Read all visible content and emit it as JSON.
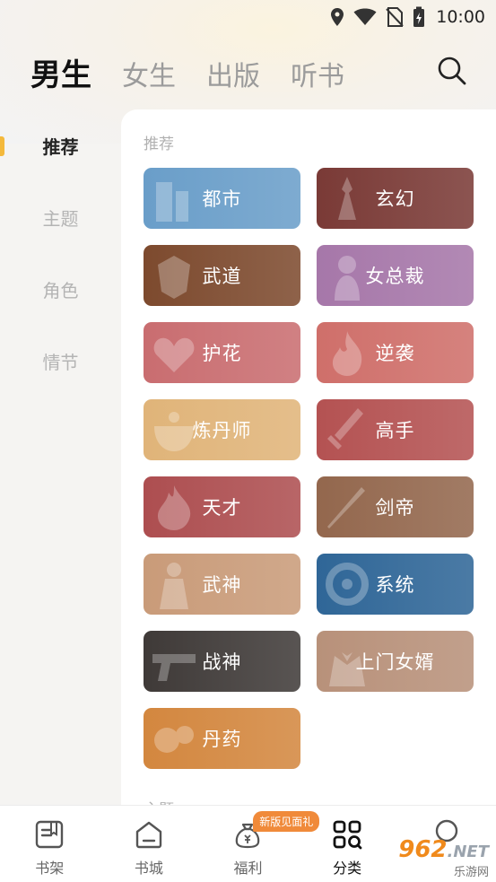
{
  "status_bar": {
    "time": "10:00",
    "icons": [
      "location-icon",
      "wifi-icon",
      "no-sim-icon",
      "battery-charging-icon"
    ]
  },
  "top_tabs": [
    {
      "label": "男生",
      "active": true
    },
    {
      "label": "女生",
      "active": false
    },
    {
      "label": "出版",
      "active": false
    },
    {
      "label": "听书",
      "active": false
    }
  ],
  "search_icon": "search-icon",
  "sidebar": {
    "items": [
      {
        "label": "推荐",
        "active": true
      },
      {
        "label": "主题",
        "active": false
      },
      {
        "label": "角色",
        "active": false
      },
      {
        "label": "情节",
        "active": false
      }
    ],
    "indicator_color": "#f4b93c"
  },
  "panel": {
    "section_title": "推荐",
    "next_section_title": "主题",
    "categories": [
      {
        "label": "都市",
        "color": "#6a9ec9",
        "icon": "building-icon"
      },
      {
        "label": "玄幻",
        "color": "#7a3a36",
        "icon": "warrior-icon"
      },
      {
        "label": "武道",
        "color": "#7d4a2e",
        "icon": "armor-icon"
      },
      {
        "label": "女总裁",
        "color": "#a677a9",
        "icon": "woman-icon"
      },
      {
        "label": "护花",
        "color": "#c96d70",
        "icon": "heart-icon"
      },
      {
        "label": "逆袭",
        "color": "#cf6f6a",
        "icon": "flame-icon"
      },
      {
        "label": "炼丹师",
        "color": "#e0b479",
        "icon": "cauldron-icon"
      },
      {
        "label": "高手",
        "color": "#b45252",
        "icon": "sword-icon"
      },
      {
        "label": "天才",
        "color": "#ad4e50",
        "icon": "fire-icon"
      },
      {
        "label": "剑帝",
        "color": "#93674d",
        "icon": "blade-icon"
      },
      {
        "label": "武神",
        "color": "#c99b79",
        "icon": "statue-icon"
      },
      {
        "label": "系统",
        "color": "#2f6697",
        "icon": "gear-icon"
      },
      {
        "label": "战神",
        "color": "#3f3a38",
        "icon": "gun-icon"
      },
      {
        "label": "上门女婿",
        "color": "#b8917a",
        "icon": "suit-icon"
      },
      {
        "label": "丹药",
        "color": "#d3873f",
        "icon": "pill-icon"
      }
    ]
  },
  "bottom_nav": {
    "items": [
      {
        "label": "书架",
        "icon": "bookshelf-icon",
        "active": false
      },
      {
        "label": "书城",
        "icon": "home-icon",
        "active": false
      },
      {
        "label": "福利",
        "icon": "money-bag-icon",
        "active": false,
        "badge": "新版见面礼"
      },
      {
        "label": "分类",
        "icon": "category-grid-icon",
        "active": true
      },
      {
        "label": "",
        "icon": "profile-icon",
        "active": false
      }
    ]
  },
  "watermark": {
    "logo_main": "962",
    "logo_tail": ".NET",
    "sub": "乐游网"
  }
}
